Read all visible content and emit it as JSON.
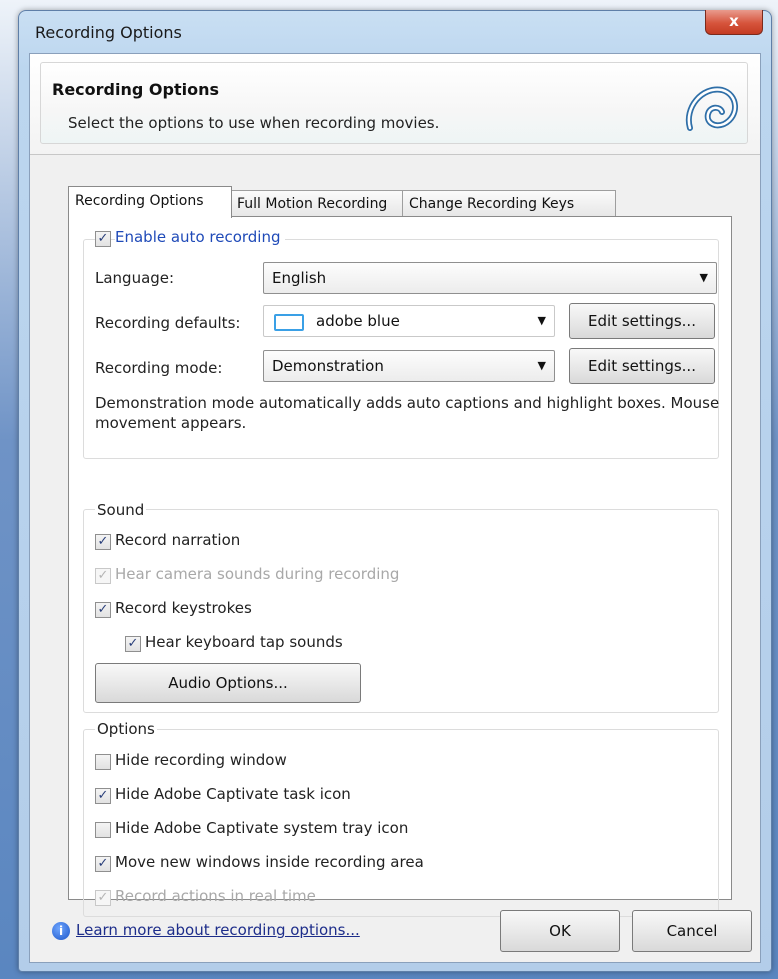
{
  "window": {
    "title": "Recording Options",
    "close_label": "x"
  },
  "header": {
    "title": "Recording Options",
    "subtitle": "Select the options to use when recording movies."
  },
  "tabs": [
    {
      "label": "Recording Options",
      "active": true
    },
    {
      "label": "Full Motion Recording",
      "active": false
    },
    {
      "label": "Change Recording Keys",
      "active": false
    }
  ],
  "auto_recording": {
    "label": "Enable auto recording",
    "checked": true,
    "language_label": "Language:",
    "language_value": "English",
    "defaults_label": "Recording defaults:",
    "defaults_value": "adobe blue",
    "defaults_swatch_color": "#3aa0e6",
    "defaults_edit_label": "Edit settings...",
    "mode_label": "Recording mode:",
    "mode_value": "Demonstration",
    "mode_edit_label": "Edit settings...",
    "mode_description": "Demonstration mode automatically adds auto captions and highlight boxes. Mouse movement appears."
  },
  "sound": {
    "legend": "Sound",
    "record_narration": {
      "label": "Record narration",
      "checked": true,
      "enabled": true
    },
    "hear_camera": {
      "label": "Hear camera sounds during recording",
      "checked": true,
      "enabled": false
    },
    "record_keystrokes": {
      "label": "Record keystrokes",
      "checked": true,
      "enabled": true
    },
    "hear_keyboard": {
      "label": "Hear keyboard tap sounds",
      "checked": true,
      "enabled": true
    },
    "audio_options_label": "Audio Options..."
  },
  "options": {
    "legend": "Options",
    "hide_window": {
      "label": "Hide recording window",
      "checked": false,
      "enabled": true
    },
    "hide_task_icon": {
      "label": "Hide Adobe Captivate task icon",
      "checked": true,
      "enabled": true
    },
    "hide_tray_icon": {
      "label": "Hide Adobe Captivate system tray icon",
      "checked": false,
      "enabled": true
    },
    "move_windows": {
      "label": "Move new windows inside recording area",
      "checked": true,
      "enabled": true
    },
    "real_time": {
      "label": "Record actions in real time",
      "checked": true,
      "enabled": false
    }
  },
  "footer": {
    "learn_more": "Learn more about recording options...",
    "ok_label": "OK",
    "cancel_label": "Cancel"
  },
  "check_glyph": "✓"
}
